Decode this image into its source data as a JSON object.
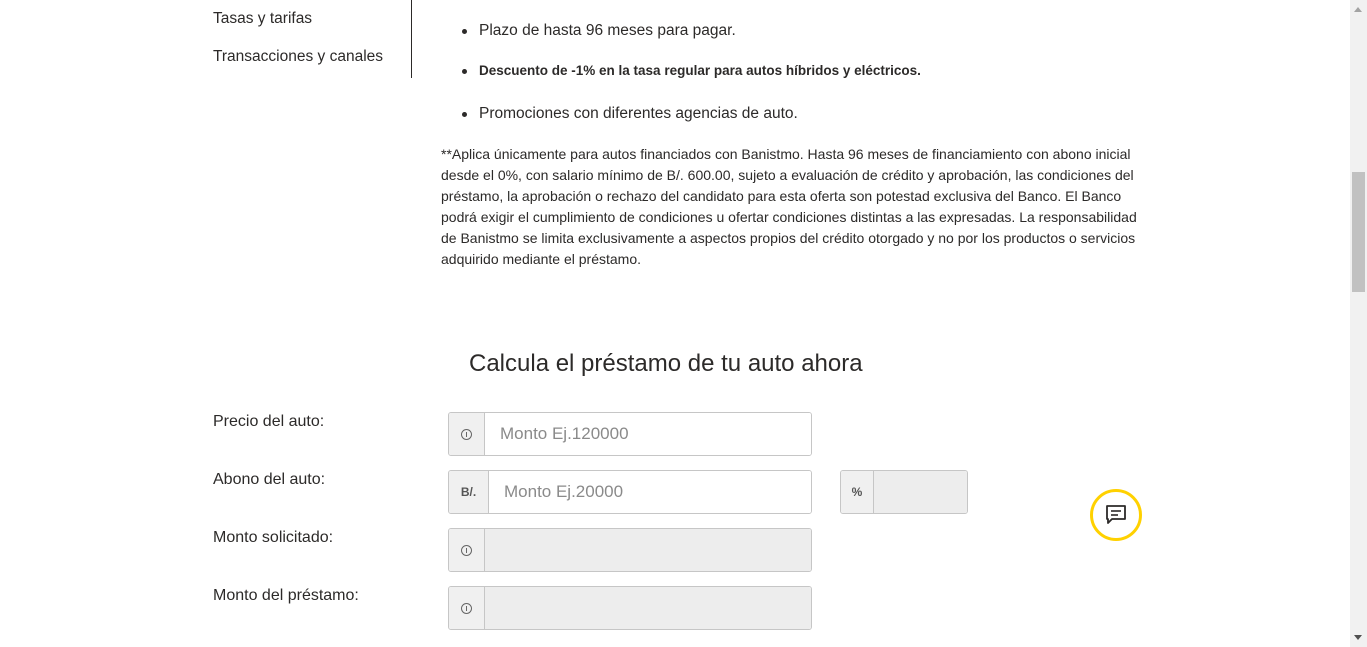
{
  "side_nav": {
    "items": [
      {
        "label": "Tasas y tarifas"
      },
      {
        "label": "Transacciones y canales"
      }
    ]
  },
  "benefits": [
    "Plazo de hasta 96 meses para pagar.",
    "Descuento de -1% en la tasa regular para autos híbridos y eléctricos.",
    "Promociones con diferentes agencias de auto."
  ],
  "disclaimer": "**Aplica únicamente para autos financiados con Banistmo. Hasta 96 meses de financiamiento con abono inicial desde el 0%, con salario mínimo de B/. 600.00, sujeto a evaluación de crédito y aprobación, las condiciones del préstamo, la aprobación o rechazo del candidato para esta oferta son potestad exclusiva del Banco. El Banco podrá exigir el cumplimiento de condiciones u ofertar condiciones distintas a las expresadas. La responsabilidad de Banistmo se limita exclusivamente a aspectos propios del crédito otorgado y no por los productos o servicios adquirido mediante el préstamo.",
  "calculator": {
    "title": "Calcula el préstamo de tu auto ahora",
    "car_price": {
      "label": "Precio del auto:",
      "placeholder": "Monto Ej.120000",
      "addon_icon": "info-icon"
    },
    "down_payment": {
      "label": "Abono del auto:",
      "placeholder": "Monto Ej.20000",
      "addon": "B/.",
      "percent_addon": "%",
      "percent_value": ""
    },
    "requested_amount": {
      "label": "Monto solicitado:",
      "value": "",
      "addon_icon": "info-icon"
    },
    "loan_amount": {
      "label": "Monto del préstamo:",
      "value": "",
      "addon_icon": "info-icon"
    }
  },
  "chat_button": {
    "icon": "chat-icon",
    "accent_color": "#ffd100"
  }
}
